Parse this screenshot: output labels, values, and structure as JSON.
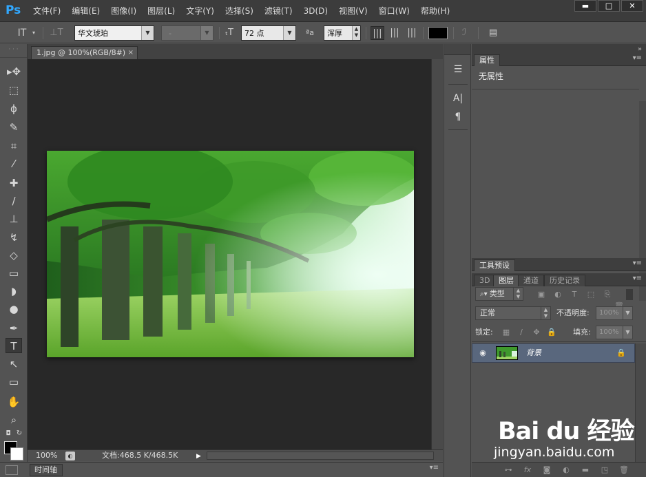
{
  "app": {
    "logo": "Ps"
  },
  "menu": [
    "文件(F)",
    "编辑(E)",
    "图像(I)",
    "图层(L)",
    "文字(Y)",
    "选择(S)",
    "滤镜(T)",
    "3D(D)",
    "视图(V)",
    "窗口(W)",
    "帮助(H)"
  ],
  "window_controls": {
    "minimize": "▬",
    "maximize": "□",
    "close": "✕"
  },
  "options": {
    "tool_icon": "text-tool-icon",
    "font_family": "华文琥珀",
    "font_style": "-",
    "font_size": "72 点",
    "aa_label": "ªa",
    "antialias": "浑厚",
    "text_color": "#000000"
  },
  "document": {
    "tab_title": "1.jpg @ 100%(RGB/8#)",
    "tab_close": "×",
    "zoom": "100%",
    "doc_size": "文档:468.5 K/468.5K"
  },
  "timeline": {
    "label": "时间轴"
  },
  "properties": {
    "tab": "属性",
    "content": "无属性"
  },
  "layers_panel": {
    "top_tab": "工具预设",
    "tabs": [
      "3D",
      "图层",
      "通道",
      "历史记录"
    ],
    "active_tab": "图层",
    "filter_kind": "类型",
    "blend_mode": "正常",
    "opacity_label": "不透明度:",
    "opacity_value": "100%",
    "lock_label": "锁定:",
    "fill_label": "填充:",
    "fill_value": "100%",
    "layers": [
      {
        "name": "背景",
        "visible": true,
        "locked": true
      }
    ]
  },
  "watermark": {
    "logo": "Bai du 经验",
    "url": "jingyan.baidu.com"
  },
  "colors": {
    "menubar": "#3c3c3c",
    "workspace": "#282828",
    "panel": "#535353",
    "selected_layer": "#59677d",
    "ps_accent": "#31a8ff"
  }
}
